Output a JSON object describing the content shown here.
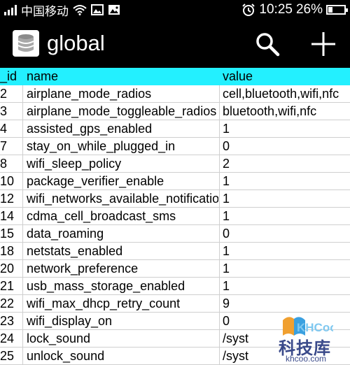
{
  "status_bar": {
    "carrier": "中国移动",
    "time": "10:25",
    "battery_percent": "26%",
    "battery_level": 0.26
  },
  "app_bar": {
    "title": "global"
  },
  "table": {
    "headers": {
      "id": "_id",
      "name": "name",
      "value": "value"
    },
    "rows": [
      {
        "id": "2",
        "name": "airplane_mode_radios",
        "value": "cell,bluetooth,wifi,nfc"
      },
      {
        "id": "3",
        "name": "airplane_mode_toggleable_radios",
        "value": "bluetooth,wifi,nfc"
      },
      {
        "id": "4",
        "name": "assisted_gps_enabled",
        "value": "1"
      },
      {
        "id": "7",
        "name": "stay_on_while_plugged_in",
        "value": "0"
      },
      {
        "id": "8",
        "name": "wifi_sleep_policy",
        "value": "2"
      },
      {
        "id": "10",
        "name": "package_verifier_enable",
        "value": "1"
      },
      {
        "id": "12",
        "name": "wifi_networks_available_notification_on",
        "value": "1"
      },
      {
        "id": "14",
        "name": "cdma_cell_broadcast_sms",
        "value": "1"
      },
      {
        "id": "15",
        "name": "data_roaming",
        "value": "0"
      },
      {
        "id": "18",
        "name": "netstats_enabled",
        "value": "1"
      },
      {
        "id": "20",
        "name": "network_preference",
        "value": "1"
      },
      {
        "id": "21",
        "name": "usb_mass_storage_enabled",
        "value": "1"
      },
      {
        "id": "22",
        "name": "wifi_max_dhcp_retry_count",
        "value": "9"
      },
      {
        "id": "23",
        "name": "wifi_display_on",
        "value": "0"
      },
      {
        "id": "24",
        "name": "lock_sound",
        "value": "/syst"
      },
      {
        "id": "25",
        "name": "unlock_sound",
        "value": "/syst"
      }
    ]
  },
  "watermark": {
    "logo_text": "KHCoo",
    "cn_text": "科技库",
    "url": "khcoo.com"
  },
  "icons": {
    "app": "database-icon",
    "search": "search-icon",
    "add": "plus-icon"
  },
  "colors": {
    "header_bg": "#23f0ff",
    "bar_bg": "#000000"
  }
}
